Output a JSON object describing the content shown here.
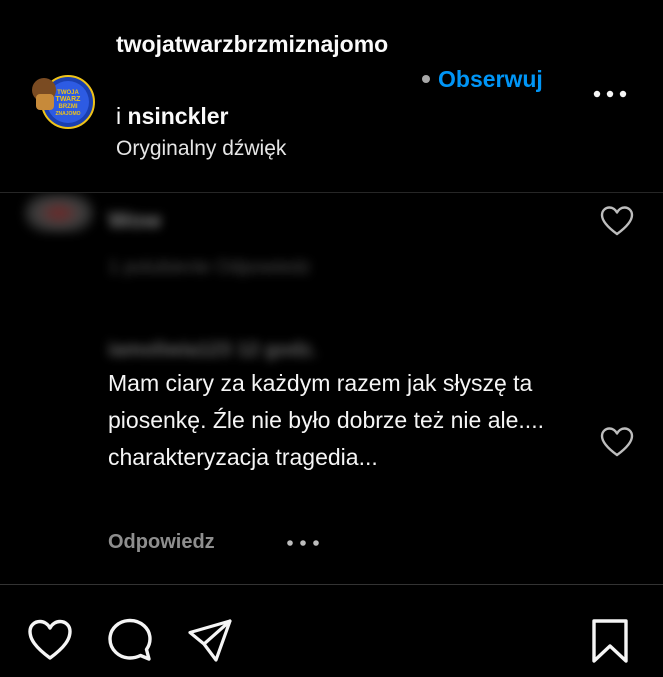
{
  "post_header": {
    "username": "twojatwarzbrzmiznajomo",
    "coauthor_prefix": "i",
    "coauthor": "nsinckler",
    "audio_label": "Oryginalny dźwięk",
    "follow_label": "Obserwuj",
    "avatar_label": "TWOJA TWARZ BRZMI ZNAJOMO",
    "accent_color": "#0095f6"
  },
  "comments": [
    {
      "blurred": true,
      "username": "· · ·",
      "text": "Wow",
      "meta": "1 polubienie   Odpowiedz"
    },
    {
      "blurred_username": "iamoliwia123  12 godz.",
      "text": "Mam ciary za każdym razem jak słyszę ta piosenkę. Źle nie było dobrze też nie ale.... charakteryzacja tragedia...",
      "reply_label": "Odpowiedz"
    }
  ],
  "bottom_bar": {
    "icons": [
      "heart-icon",
      "comment-icon",
      "share-icon",
      "bookmark-icon"
    ]
  }
}
